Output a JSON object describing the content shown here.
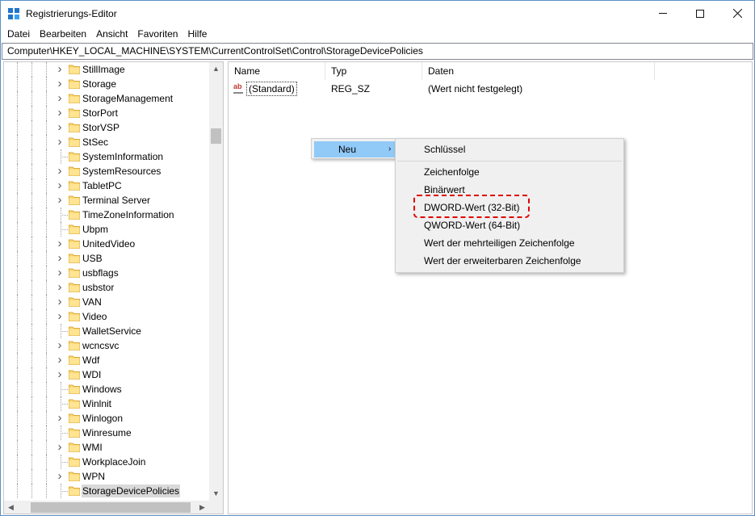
{
  "window": {
    "title": "Registrierungs-Editor"
  },
  "menubar": {
    "items": [
      "Datei",
      "Bearbeiten",
      "Ansicht",
      "Favoriten",
      "Hilfe"
    ]
  },
  "address": {
    "path": "Computer\\HKEY_LOCAL_MACHINE\\SYSTEM\\CurrentControlSet\\Control\\StorageDevicePolicies"
  },
  "tree": {
    "items": [
      {
        "label": "StillImage",
        "expandable": true
      },
      {
        "label": "Storage",
        "expandable": true
      },
      {
        "label": "StorageManagement",
        "expandable": true
      },
      {
        "label": "StorPort",
        "expandable": true
      },
      {
        "label": "StorVSP",
        "expandable": true
      },
      {
        "label": "StSec",
        "expandable": true
      },
      {
        "label": "SystemInformation",
        "expandable": false
      },
      {
        "label": "SystemResources",
        "expandable": true
      },
      {
        "label": "TabletPC",
        "expandable": true
      },
      {
        "label": "Terminal Server",
        "expandable": true
      },
      {
        "label": "TimeZoneInformation",
        "expandable": false
      },
      {
        "label": "Ubpm",
        "expandable": false
      },
      {
        "label": "UnitedVideo",
        "expandable": true
      },
      {
        "label": "USB",
        "expandable": true
      },
      {
        "label": "usbflags",
        "expandable": true
      },
      {
        "label": "usbstor",
        "expandable": true
      },
      {
        "label": "VAN",
        "expandable": true
      },
      {
        "label": "Video",
        "expandable": true
      },
      {
        "label": "WalletService",
        "expandable": false
      },
      {
        "label": "wcncsvc",
        "expandable": true
      },
      {
        "label": "Wdf",
        "expandable": true
      },
      {
        "label": "WDI",
        "expandable": true
      },
      {
        "label": "Windows",
        "expandable": false
      },
      {
        "label": "Winlnit",
        "expandable": false
      },
      {
        "label": "Winlogon",
        "expandable": true
      },
      {
        "label": "Winresume",
        "expandable": false
      },
      {
        "label": "WMI",
        "expandable": true
      },
      {
        "label": "WorkplaceJoin",
        "expandable": false
      },
      {
        "label": "WPN",
        "expandable": true
      },
      {
        "label": "StorageDevicePolicies",
        "expandable": false,
        "selected": true
      }
    ]
  },
  "list": {
    "columns": [
      "Name",
      "Typ",
      "Daten"
    ],
    "rows": [
      {
        "name": "(Standard)",
        "type": "REG_SZ",
        "data": "(Wert nicht festgelegt)"
      }
    ]
  },
  "context_menu": {
    "new_label": "Neu",
    "submenu": {
      "key": "Schlüssel",
      "items": [
        "Zeichenfolge",
        "Binärwert",
        "DWORD-Wert (32-Bit)",
        "QWORD-Wert (64-Bit)",
        "Wert der mehrteiligen Zeichenfolge",
        "Wert der erweiterbaren Zeichenfolge"
      ]
    },
    "highlighted_item": "DWORD-Wert (32-Bit)"
  },
  "colors": {
    "menu_hover": "#91c9f7",
    "highlight_dash": "#e00000",
    "window_border": "#5a8fc8"
  }
}
